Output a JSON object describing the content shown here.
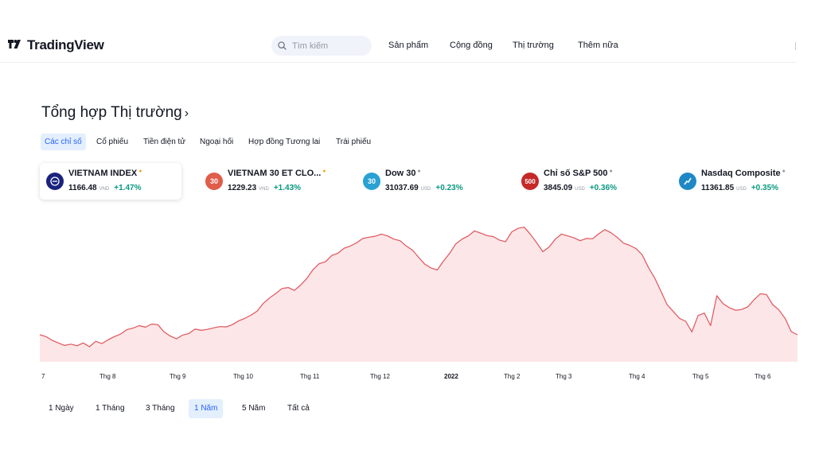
{
  "header": {
    "logo_text": "TradingView",
    "search_placeholder": "Tìm kiếm",
    "nav": [
      "Sản phẩm",
      "Cộng đồng",
      "Thị trường",
      "Thêm nữa"
    ]
  },
  "page": {
    "title": "Tổng hợp Thị trường",
    "title_chevron": "›"
  },
  "tabs": [
    {
      "label": "Các chỉ số",
      "active": true
    },
    {
      "label": "Cổ phiếu",
      "active": false
    },
    {
      "label": "Tiền điện tử",
      "active": false
    },
    {
      "label": "Ngoại hối",
      "active": false
    },
    {
      "label": "Hợp đồng Tương lai",
      "active": false
    },
    {
      "label": "Trái phiếu",
      "active": false
    }
  ],
  "tickers": [
    {
      "name": "VIETNAM INDEX",
      "icon_text": "",
      "icon_color": "#1a237e",
      "dot": "●",
      "dot_color": "#f5a623",
      "price": "1166.48",
      "currency": "VND",
      "change": "+1.47%",
      "active": true
    },
    {
      "name": "VIETNAM 30 ET CLO...",
      "icon_text": "30",
      "icon_color": "#e05c4b",
      "dot": "●",
      "dot_color": "#f5a623",
      "price": "1229.23",
      "currency": "VND",
      "change": "+1.43%",
      "active": false
    },
    {
      "name": "Dow 30",
      "icon_text": "30",
      "icon_color": "#2aa1d3",
      "dot": "●",
      "dot_color": "#9598a1",
      "price": "31037.69",
      "currency": "USD",
      "change": "+0.23%",
      "active": false
    },
    {
      "name": "Chỉ số S&P 500",
      "icon_text": "500",
      "icon_color": "#c62828",
      "dot": "●",
      "dot_color": "#9598a1",
      "price": "3845.09",
      "currency": "USD",
      "change": "+0.36%",
      "active": false
    },
    {
      "name": "Nasdaq Composite",
      "icon_text": "",
      "icon_color": "#1e88c7",
      "dot": "●",
      "dot_color": "#9598a1",
      "price": "11361.85",
      "currency": "USD",
      "change": "+0.35%",
      "active": false
    }
  ],
  "chart_data": {
    "type": "area",
    "series": [
      {
        "values": [
          1166,
          1160,
          1148,
          1140,
          1132,
          1136,
          1131,
          1140,
          1128,
          1145,
          1138,
          1150,
          1160,
          1168,
          1182,
          1187,
          1195,
          1190,
          1200,
          1198,
          1175,
          1162,
          1153,
          1165,
          1170,
          1184,
          1180,
          1183,
          1188,
          1192,
          1191,
          1198,
          1210,
          1218,
          1228,
          1241,
          1266,
          1283,
          1297,
          1313,
          1316,
          1307,
          1324,
          1345,
          1373,
          1392,
          1398,
          1418,
          1425,
          1441,
          1448,
          1458,
          1472,
          1476,
          1479,
          1486,
          1480,
          1470,
          1465,
          1448,
          1435,
          1412,
          1390,
          1378,
          1372,
          1400,
          1425,
          1455,
          1470,
          1480,
          1496,
          1489,
          1481,
          1478,
          1467,
          1462,
          1493,
          1504,
          1508,
          1485,
          1458,
          1430,
          1445,
          1470,
          1486,
          1480,
          1474,
          1465,
          1472,
          1471,
          1487,
          1500,
          1490,
          1475,
          1457,
          1450,
          1440,
          1420,
          1380,
          1347,
          1305,
          1262,
          1240,
          1218,
          1209,
          1175,
          1227,
          1235,
          1195,
          1290,
          1265,
          1252,
          1244,
          1246,
          1255,
          1277,
          1296,
          1294,
          1262,
          1245,
          1218,
          1176,
          1166
        ]
      }
    ],
    "x_ticks": [
      {
        "label": "7",
        "bold": false
      },
      {
        "label": "Thg 8",
        "bold": false
      },
      {
        "label": "Thg 9",
        "bold": false
      },
      {
        "label": "Thg 10",
        "bold": false
      },
      {
        "label": "Thg 11",
        "bold": false
      },
      {
        "label": "Thg 12",
        "bold": false
      },
      {
        "label": "2022",
        "bold": true
      },
      {
        "label": "Thg 2",
        "bold": false
      },
      {
        "label": "Thg 3",
        "bold": false
      },
      {
        "label": "Thg 4",
        "bold": false
      },
      {
        "label": "Thg 5",
        "bold": false
      },
      {
        "label": "Thg 6",
        "bold": false
      }
    ],
    "ylim": [
      1080,
      1540
    ],
    "grid": false,
    "line_color": "#e0545c",
    "fill_color": "#fce6e7"
  },
  "ranges": [
    {
      "label": "1 Ngày",
      "active": false
    },
    {
      "label": "1 Tháng",
      "active": false
    },
    {
      "label": "3 Tháng",
      "active": false
    },
    {
      "label": "1 Năm",
      "active": true
    },
    {
      "label": "5 Năm",
      "active": false
    },
    {
      "label": "Tất cả",
      "active": false
    }
  ]
}
